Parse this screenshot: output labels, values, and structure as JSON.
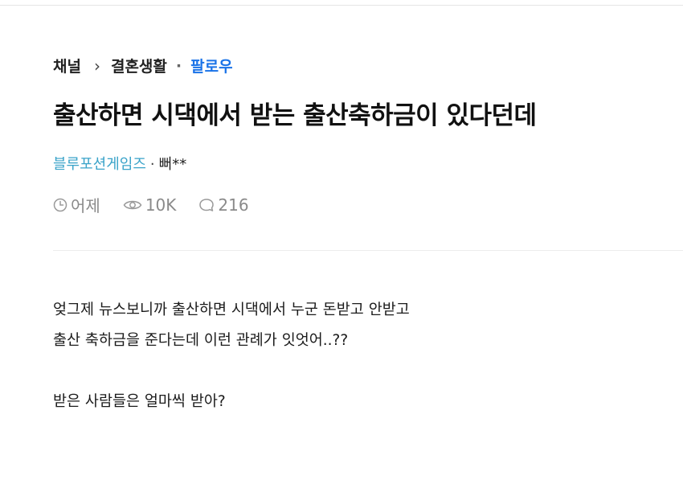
{
  "breadcrumb": {
    "channel": "채널",
    "separator": "›",
    "board": "결혼생활",
    "dot": "·",
    "follow": "팔로우"
  },
  "post": {
    "title": "출산하면 시댁에서 받는 출산축하금이 있다던데",
    "company": "블루포션게임즈",
    "author_separator": "·",
    "author": "뻐**",
    "time": "어제",
    "views": "10K",
    "comments": "216",
    "body": [
      "엊그제 뉴스보니까 출산하면 시댁에서 누군 돈받고 안받고",
      "출산 축하금을 준다는데 이런 관례가 잇엇어..??",
      "",
      "받은 사람들은 얼마씩 받아?"
    ]
  },
  "icons": {
    "time": "clock-icon",
    "views": "eye-icon",
    "comments": "comment-bubble-icon"
  },
  "colors": {
    "follow": "#1a73e8",
    "company": "#3aa3c9",
    "meta": "#8a8a8a"
  }
}
